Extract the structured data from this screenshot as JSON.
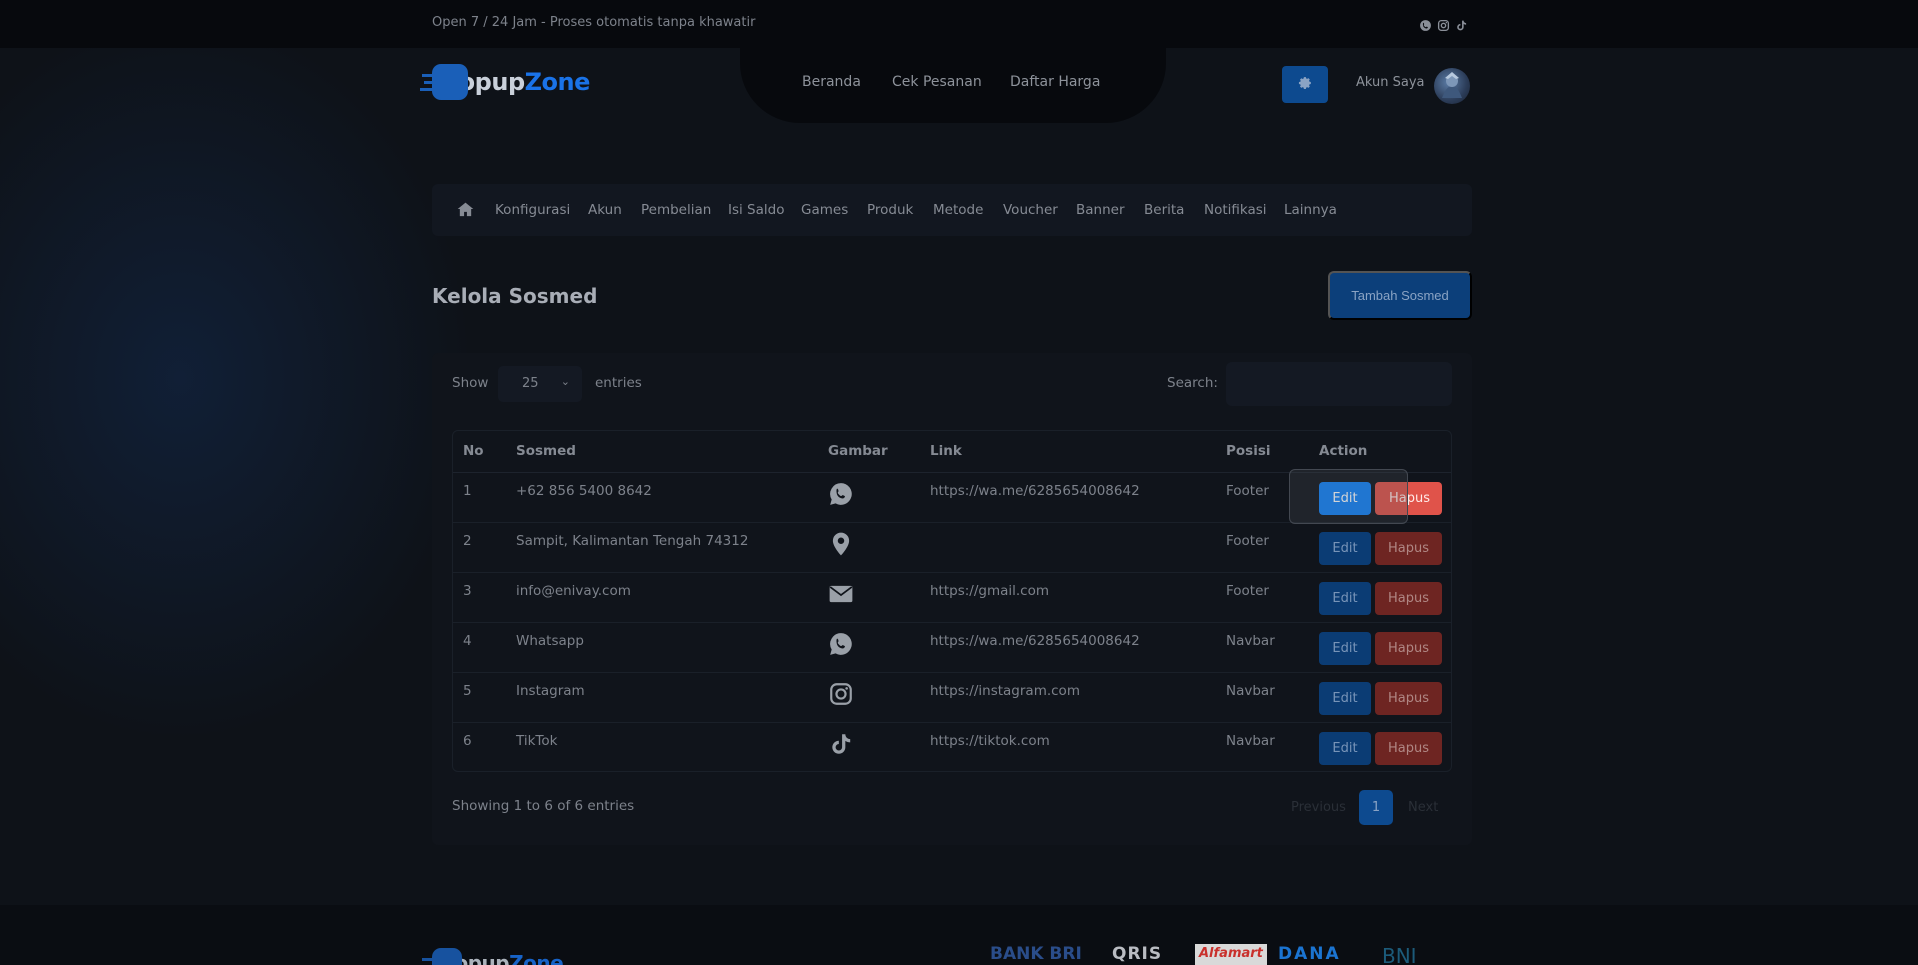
{
  "topbar": {
    "tagline": "Open 7 / 24 Jam - Proses otomatis tanpa khawatir",
    "social_icons": [
      "whatsapp-icon",
      "instagram-icon",
      "tiktok-icon"
    ]
  },
  "brand": {
    "part1": "Topup",
    "part2": "Zone",
    "accent": "#1a73e8"
  },
  "nav": {
    "items": [
      "Beranda",
      "Cek Pesanan",
      "Daftar Harga"
    ]
  },
  "account": {
    "label": "Akun Saya"
  },
  "admin_nav": {
    "home_icon": "home-icon",
    "items": [
      "Konfigurasi",
      "Akun",
      "Pembelian",
      "Isi Saldo",
      "Games",
      "Produk",
      "Metode",
      "Voucher",
      "Banner",
      "Berita",
      "Notifikasi",
      "Lainnya"
    ]
  },
  "page": {
    "title": "Kelola Sosmed",
    "add_button": "Tambah Sosmed"
  },
  "table_controls": {
    "show_label": "Show",
    "length_value": "25",
    "entries_label": "entries",
    "search_label": "Search:",
    "search_value": ""
  },
  "table": {
    "headers": [
      "No",
      "Sosmed",
      "Gambar",
      "Link",
      "Posisi",
      "Action"
    ],
    "rows": [
      {
        "no": "1",
        "sosmed": "+62 856 5400 8642",
        "icon": "whatsapp-icon",
        "link": "https://wa.me/6285654008642",
        "posisi": "Footer"
      },
      {
        "no": "2",
        "sosmed": "Sampit, Kalimantan Tengah 74312",
        "icon": "location-pin-icon",
        "link": "",
        "posisi": "Footer"
      },
      {
        "no": "3",
        "sosmed": "info@enivay.com",
        "icon": "envelope-icon",
        "link": "https://gmail.com",
        "posisi": "Footer"
      },
      {
        "no": "4",
        "sosmed": "Whatsapp",
        "icon": "whatsapp-icon",
        "link": "https://wa.me/6285654008642",
        "posisi": "Navbar"
      },
      {
        "no": "5",
        "sosmed": "Instagram",
        "icon": "instagram-icon",
        "link": "https://instagram.com",
        "posisi": "Navbar"
      },
      {
        "no": "6",
        "sosmed": "TikTok",
        "icon": "tiktok-icon",
        "link": "https://tiktok.com",
        "posisi": "Navbar"
      }
    ],
    "edit_label": "Edit",
    "delete_label": "Hapus"
  },
  "pagination": {
    "info": "Showing 1 to 6 of 6 entries",
    "previous": "Previous",
    "current": "1",
    "next": "Next"
  },
  "footer": {
    "payments": [
      "BANK BRI",
      "QRIS",
      "Alfamart",
      "DANA",
      "BNI"
    ]
  },
  "colors": {
    "background": "#0e1218",
    "primary": "#1082f8",
    "danger": "#e0534a"
  }
}
